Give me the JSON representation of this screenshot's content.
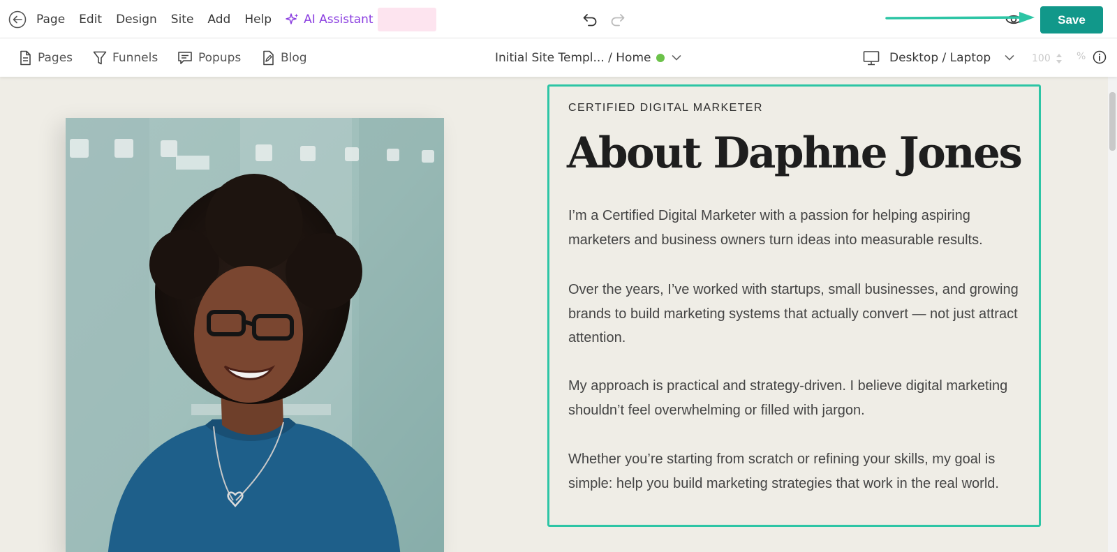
{
  "menu": {
    "items": [
      "Page",
      "Edit",
      "Design",
      "Site",
      "Add",
      "Help"
    ],
    "ai_label": "AI Assistant",
    "save_label": "Save"
  },
  "toolbar": {
    "pages": "Pages",
    "funnels": "Funnels",
    "popups": "Popups",
    "blog": "Blog",
    "site_name": "Initial Site Templ... / Home",
    "device": "Desktop / Laptop",
    "zoom": "100",
    "zoom_unit": "%"
  },
  "content": {
    "eyebrow": "CERTIFIED DIGITAL MARKETER",
    "heading": "About Daphne Jones",
    "paragraphs": [
      "I’m a Certified Digital Marketer with a passion for helping aspiring marketers and business owners turn ideas into measurable results.",
      "Over the years, I’ve worked with startups, small businesses, and growing brands to build marketing systems that actually convert — not just attract attention.",
      "My approach is practical and strategy-driven. I believe digital marketing shouldn’t feel overwhelming or filled with jargon.",
      "Whether you’re starting from scratch or refining your skills, my goal is simple: help you build marketing strategies that work in the real world."
    ]
  },
  "colors": {
    "accent": "#11988a",
    "selection": "#2dc5a5",
    "ai": "#8b3fe0",
    "status": "#6cc24a",
    "canvas_bg": "#efede6"
  },
  "icons": [
    "back-arrow-icon",
    "sparkle-icon",
    "undo-icon",
    "redo-icon",
    "eye-icon",
    "document-icon",
    "funnel-icon",
    "popup-icon",
    "blog-icon",
    "chevron-down-icon",
    "monitor-icon",
    "info-icon"
  ]
}
